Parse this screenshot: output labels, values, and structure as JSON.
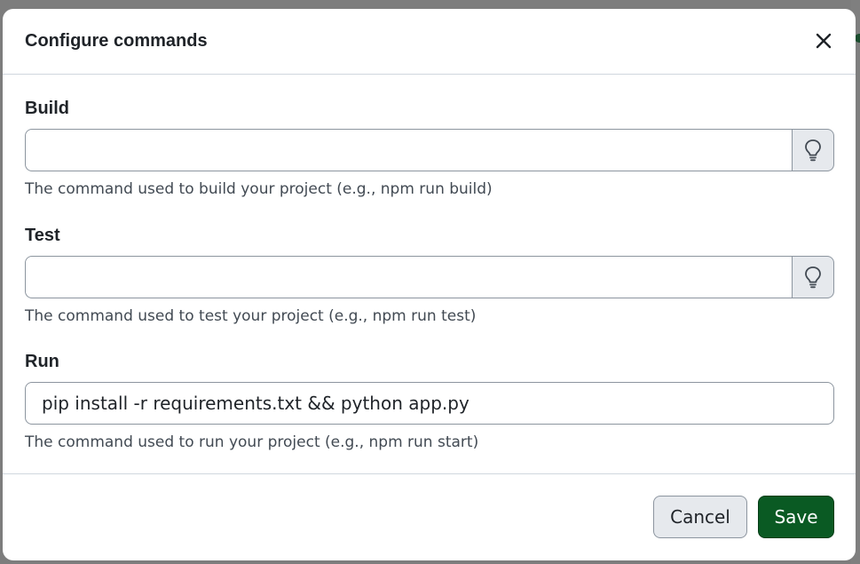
{
  "dialog": {
    "title": "Configure commands",
    "close_icon": "close-icon"
  },
  "fields": {
    "build": {
      "label": "Build",
      "value": "",
      "hint_icon": "lightbulb-icon",
      "help": "The command used to build your project (e.g., npm run build)"
    },
    "test": {
      "label": "Test",
      "value": "",
      "hint_icon": "lightbulb-icon",
      "help": "The command used to test your project (e.g., npm run test)"
    },
    "run": {
      "label": "Run",
      "value": "pip install -r requirements.txt && python app.py",
      "help": "The command used to run your project (e.g., npm run start)"
    }
  },
  "footer": {
    "cancel_label": "Cancel",
    "save_label": "Save"
  },
  "colors": {
    "save_button": "#0a5a23",
    "cancel_button": "#e6e9ed",
    "hint_button": "#e6e9ed",
    "border": "#8c959f"
  }
}
